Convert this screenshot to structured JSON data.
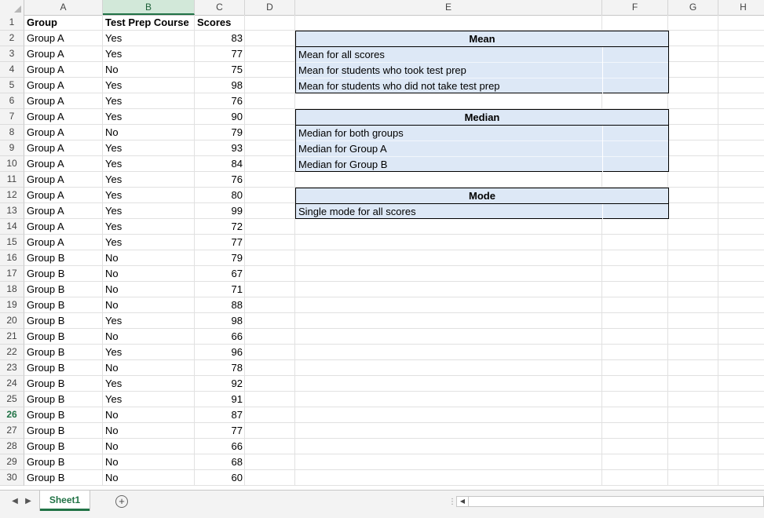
{
  "columns": [
    "A",
    "B",
    "C",
    "D",
    "E",
    "F",
    "G",
    "H"
  ],
  "header": {
    "group": "Group",
    "test_prep": "Test Prep Course",
    "scores": "Scores"
  },
  "rows": [
    {
      "group": "Group A",
      "prep": "Yes",
      "score": "83"
    },
    {
      "group": "Group A",
      "prep": "Yes",
      "score": "77"
    },
    {
      "group": "Group A",
      "prep": "No",
      "score": "75"
    },
    {
      "group": "Group A",
      "prep": "Yes",
      "score": "98"
    },
    {
      "group": "Group A",
      "prep": "Yes",
      "score": "76"
    },
    {
      "group": "Group A",
      "prep": "Yes",
      "score": "90"
    },
    {
      "group": "Group A",
      "prep": "No",
      "score": "79"
    },
    {
      "group": "Group A",
      "prep": "Yes",
      "score": "93"
    },
    {
      "group": "Group A",
      "prep": "Yes",
      "score": "84"
    },
    {
      "group": "Group A",
      "prep": "Yes",
      "score": "76"
    },
    {
      "group": "Group A",
      "prep": "Yes",
      "score": "80"
    },
    {
      "group": "Group A",
      "prep": "Yes",
      "score": "99"
    },
    {
      "group": "Group A",
      "prep": "Yes",
      "score": "72"
    },
    {
      "group": "Group A",
      "prep": "Yes",
      "score": "77"
    },
    {
      "group": "Group B",
      "prep": "No",
      "score": "79"
    },
    {
      "group": "Group B",
      "prep": "No",
      "score": "67"
    },
    {
      "group": "Group B",
      "prep": "No",
      "score": "71"
    },
    {
      "group": "Group B",
      "prep": "No",
      "score": "88"
    },
    {
      "group": "Group B",
      "prep": "Yes",
      "score": "98"
    },
    {
      "group": "Group B",
      "prep": "No",
      "score": "66"
    },
    {
      "group": "Group B",
      "prep": "Yes",
      "score": "96"
    },
    {
      "group": "Group B",
      "prep": "No",
      "score": "78"
    },
    {
      "group": "Group B",
      "prep": "Yes",
      "score": "92"
    },
    {
      "group": "Group B",
      "prep": "Yes",
      "score": "91"
    },
    {
      "group": "Group B",
      "prep": "No",
      "score": "87"
    },
    {
      "group": "Group B",
      "prep": "No",
      "score": "77"
    },
    {
      "group": "Group B",
      "prep": "No",
      "score": "66"
    },
    {
      "group": "Group B",
      "prep": "No",
      "score": "68"
    },
    {
      "group": "Group B",
      "prep": "No",
      "score": "60"
    }
  ],
  "selected_row": 26,
  "selected_column": "B",
  "summary": {
    "mean": {
      "title": "Mean",
      "items": [
        "Mean for all scores",
        "Mean for students who took test prep",
        "Mean for students who did not take test prep"
      ]
    },
    "median": {
      "title": "Median",
      "items": [
        "Median for both groups",
        "Median for Group A",
        "Median for Group B"
      ]
    },
    "mode": {
      "title": "Mode",
      "items": [
        "Single mode for all scores"
      ]
    }
  },
  "sheet_tab": "Sheet1",
  "colors": {
    "accent": "#217346",
    "box_fill": "#dde8f6"
  }
}
